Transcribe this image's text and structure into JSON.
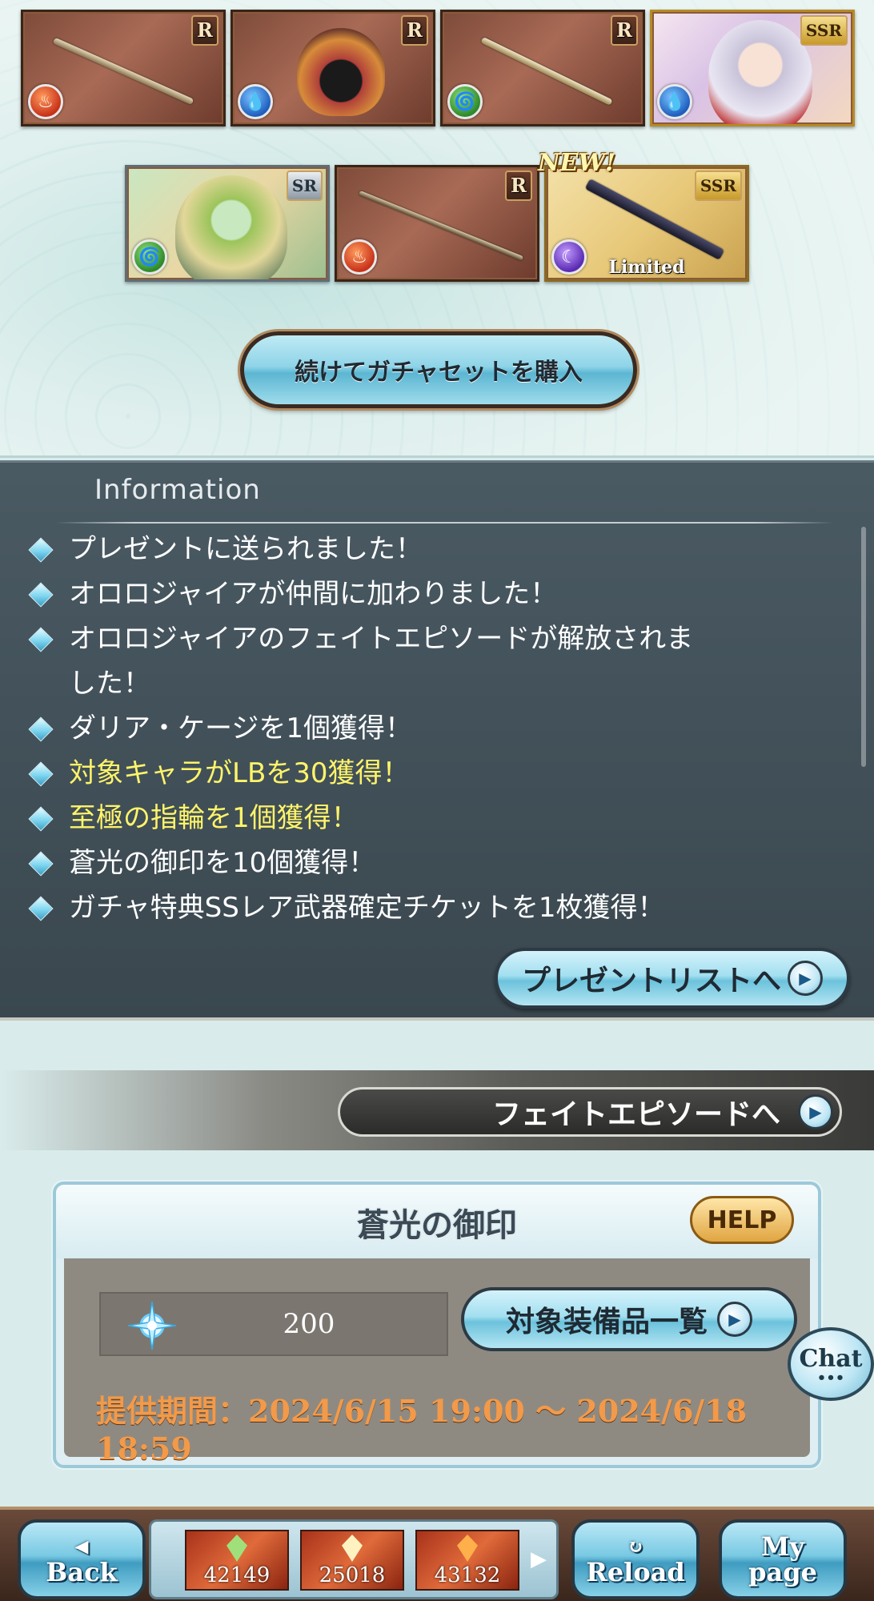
{
  "gacha": {
    "cards": [
      {
        "rarity": "R",
        "element": "fire-element-icon",
        "kind": "weapon"
      },
      {
        "rarity": "R",
        "element": "water-element-icon",
        "kind": "summon"
      },
      {
        "rarity": "R",
        "element": "wind-element-icon",
        "kind": "weapon"
      },
      {
        "rarity": "SSR",
        "element": "water-element-icon",
        "kind": "character"
      },
      {
        "rarity": "SR",
        "element": "wind-element-icon",
        "kind": "character"
      },
      {
        "rarity": "R",
        "element": "fire-element-icon",
        "kind": "weapon"
      },
      {
        "rarity": "SSR",
        "element": "dark-element-icon",
        "kind": "weapon",
        "tag": "Limited"
      }
    ],
    "new_badge": "NEW!",
    "buy_again_label": "続けてガチャセットを購入"
  },
  "information": {
    "title": "Information",
    "lines": [
      {
        "text": "プレゼントに送られました！",
        "highlight": false
      },
      {
        "text": "オロロジャイアが仲間に加わりました！",
        "highlight": false
      },
      {
        "text": "オロロジャイアのフェイトエピソードが解放されま",
        "highlight": false
      },
      {
        "text": "した！",
        "highlight": false
      },
      {
        "text": "ダリア・ケージを1個獲得！",
        "highlight": false
      },
      {
        "text": "対象キャラがLBを30獲得！",
        "highlight": true
      },
      {
        "text": "至極の指輪を1個獲得！",
        "highlight": true
      },
      {
        "text": "蒼光の御印を10個獲得！",
        "highlight": false
      },
      {
        "text": "ガチャ特典SSレア武器確定チケットを1枚獲得！",
        "highlight": false
      }
    ],
    "present_list_label": "プレゼントリストへ"
  },
  "fate_episode_label": "フェイトエピソードへ",
  "seal": {
    "title": "蒼光の御印",
    "help_label": "HELP",
    "count": "200",
    "target_equipment_label": "対象装備品一覧",
    "period": "提供期間：2024/6/15 19:00 〜 2024/6/18 18:59"
  },
  "chat_label": "Chat",
  "nav": {
    "back_label": "Back",
    "reload_label": "Reload",
    "mypage_label_1": "My",
    "mypage_label_2": "page",
    "currencies": [
      {
        "value": "42149",
        "gem_color": "#9fe07a"
      },
      {
        "value": "25018",
        "gem_color": "#fff2c0"
      },
      {
        "value": "43132",
        "gem_color": "#ffb04a"
      }
    ]
  }
}
